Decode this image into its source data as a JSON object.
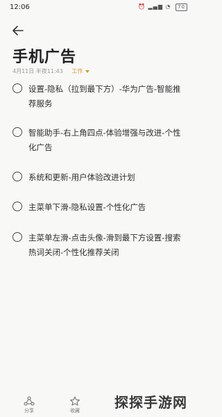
{
  "status": {
    "time": "12:06",
    "battery": "70"
  },
  "note": {
    "title": "手机广告",
    "date": "4月11日 半夜11:43",
    "folder": "工作"
  },
  "checklist": [
    {
      "text": "设置-隐私（拉到最下方）-华为广告-智能推荐服务"
    },
    {
      "text": "智能助手-右上角四点-体验增强与改进-个性化广告"
    },
    {
      "text": "系统和更新-用户体验改进计划"
    },
    {
      "text": "主菜单下滑-隐私设置-个性化广告"
    },
    {
      "text": "主菜单左滑-点击头像-滑到最下方设置-搜索热词关闭-个性化推荐关闭"
    }
  ],
  "bottom": {
    "share_label": "分享",
    "fav_label": "收藏"
  },
  "watermark": "探探手游网",
  "colors": {
    "folder": "#d39a2c",
    "background": "#f8f8f7"
  }
}
